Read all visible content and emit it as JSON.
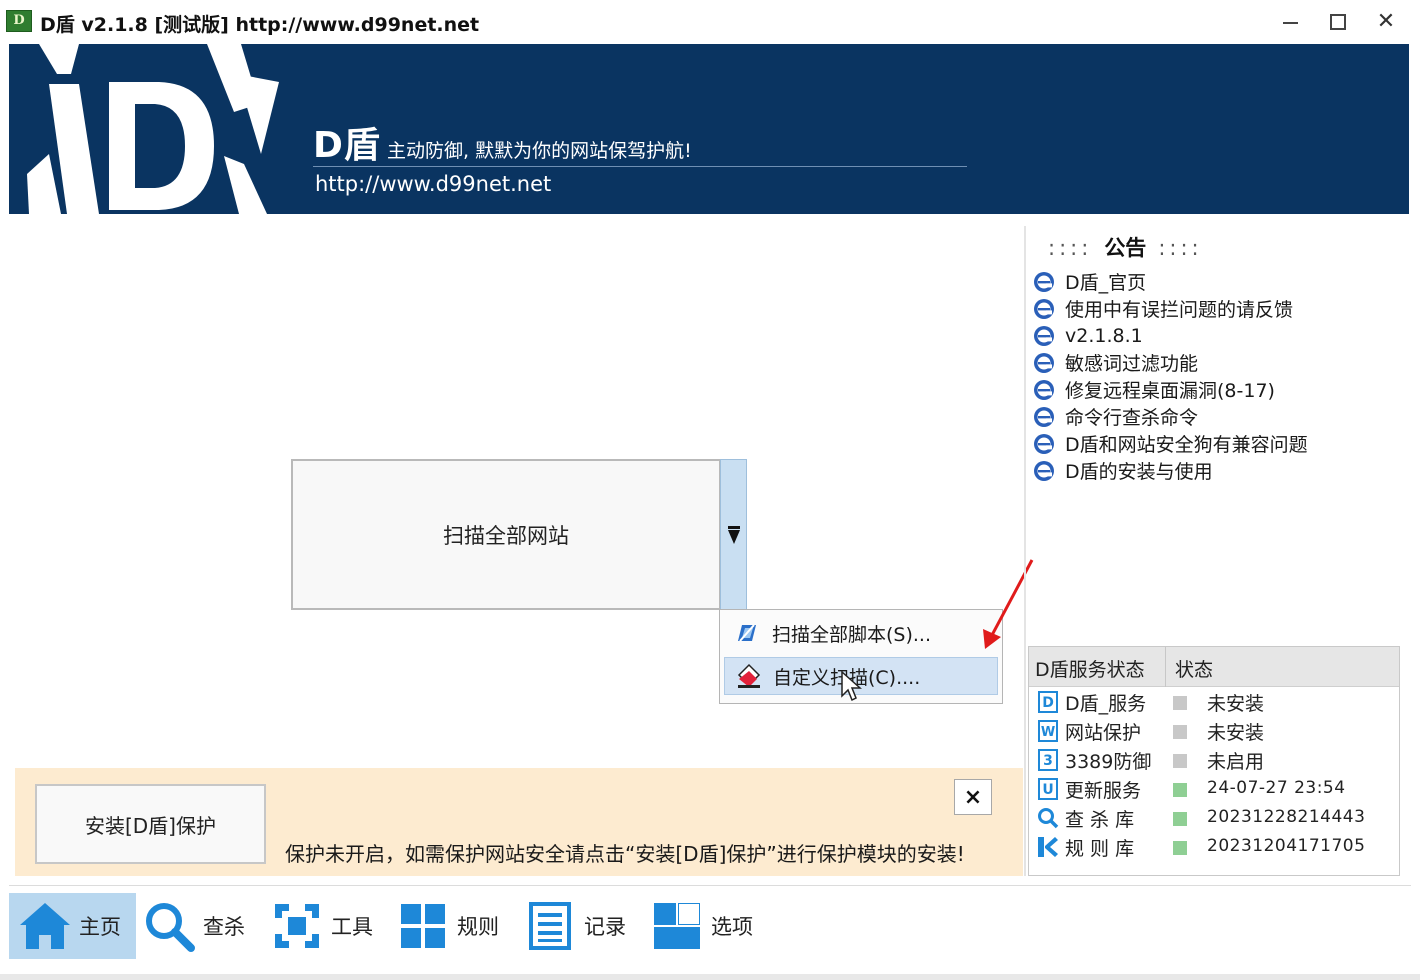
{
  "window": {
    "title": "D盾 v2.1.8 [测试版] http://www.d99net.net",
    "icon_label": "D",
    "controls": [
      "minimize-icon",
      "maximize-icon",
      "close-icon"
    ]
  },
  "banner": {
    "brand": "D盾",
    "slogan": "主动防御, 默默为你的网站保驾护航!",
    "url": "http://www.d99net.net",
    "background": "#0a3461"
  },
  "scan": {
    "main_label": "扫描全部网站",
    "menu": [
      {
        "label": "扫描全部脚本(S)...",
        "icon": "script-scan-icon"
      },
      {
        "label": "自定义扫描(C)....",
        "icon": "custom-scan-icon",
        "highlighted": true
      }
    ]
  },
  "notice": {
    "colons_left": "::::",
    "title": "公告",
    "colons_right": "::::",
    "items": [
      {
        "label": "D盾_官页"
      },
      {
        "label": "使用中有误拦问题的请反馈"
      },
      {
        "label": "v2.1.8.1"
      },
      {
        "label": "敏感词过滤功能"
      },
      {
        "label": "修复远程桌面漏洞(8-17)"
      },
      {
        "label": "命令行查杀命令"
      },
      {
        "label": "D盾和网站安全狗有兼容问题"
      },
      {
        "label": "D盾的安装与使用"
      }
    ]
  },
  "status": {
    "header_name": "D盾服务状态",
    "header_status": "状态",
    "rows": [
      {
        "icon_letter": "D",
        "name": "D盾_服务",
        "value": "未安装",
        "indicator": "#c8c8c8"
      },
      {
        "icon_letter": "W",
        "name": "网站保护",
        "value": "未安装",
        "indicator": "#c8c8c8"
      },
      {
        "icon_letter": "3",
        "name": "3389防御",
        "value": "未启用",
        "indicator": "#c8c8c8"
      },
      {
        "icon_letter": "U",
        "name": "更新服务",
        "value": "24-07-27 23:54",
        "indicator": "#8fcf94"
      },
      {
        "icon_letter": "Q",
        "name": "查 杀 库",
        "value": "20231228214443",
        "indicator": "#8fcf94"
      },
      {
        "icon_letter": "K",
        "name": "规 则 库",
        "value": "20231204171705",
        "indicator": "#8fcf94"
      }
    ]
  },
  "warning": {
    "install_label": "安装[D盾]保护",
    "close_label": "×",
    "message": "保护未开启，如需保护网站安全请点击“安装[D盾]保护”进行保护模块的安装!",
    "background": "#fdebd0"
  },
  "nav": {
    "items": [
      {
        "label": "主页",
        "icon": "home-icon",
        "active": true
      },
      {
        "label": "查杀",
        "icon": "search-icon"
      },
      {
        "label": "工具",
        "icon": "tools-icon"
      },
      {
        "label": "规则",
        "icon": "rules-icon"
      },
      {
        "label": "记录",
        "icon": "log-icon"
      },
      {
        "label": "选项",
        "icon": "options-icon"
      }
    ]
  },
  "colors": {
    "accent": "#1e88d8",
    "nav_active": "#b8d7ef",
    "menu_highlight": "#d3e3f4",
    "annotation": "#e01b1b"
  }
}
